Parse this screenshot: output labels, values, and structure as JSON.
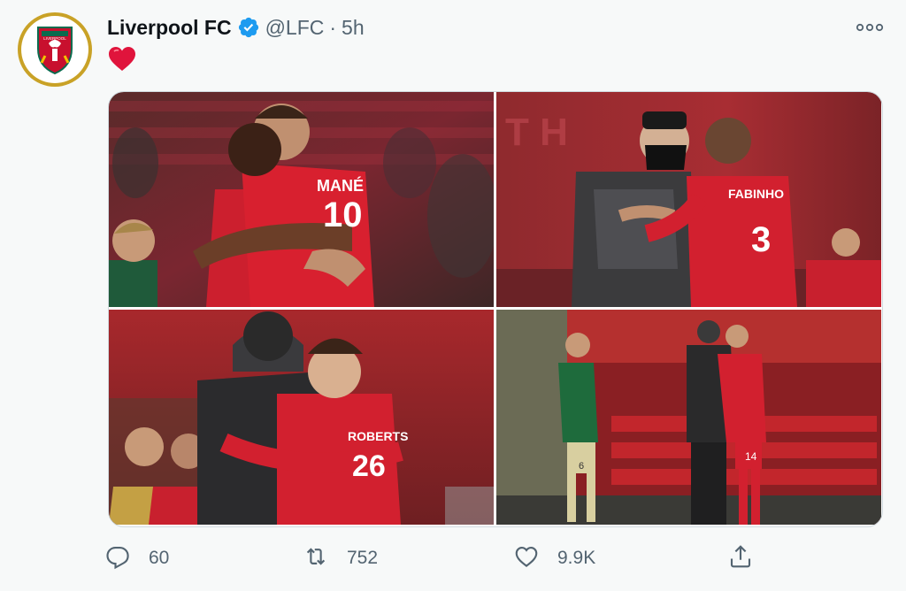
{
  "tweet": {
    "display_name": "Liverpool FC",
    "handle": "@LFC",
    "separator": "·",
    "time": "5h",
    "body_emoji": "red-heart",
    "crest_text": "LIVERPOOL",
    "photos": [
      {
        "name": "Mané and Jota embrace",
        "jersey_name": "MANÉ",
        "jersey_number": "10"
      },
      {
        "name": "Klopp with Fabinho",
        "jersey_name": "FABINHO",
        "jersey_number": "3"
      },
      {
        "name": "Robertson hug",
        "jersey_name": "ROBERTS",
        "jersey_number": "26"
      },
      {
        "name": "Henderson hug near stands",
        "jersey_number_a": "6",
        "jersey_number_b": "14"
      }
    ],
    "actions": {
      "replies": "60",
      "retweets": "752",
      "likes": "9.9K"
    }
  },
  "colors": {
    "verified": "#1d9bf0",
    "text_secondary": "#536471",
    "lfc_red": "#c8102e",
    "crest_gold": "#c9a227"
  }
}
